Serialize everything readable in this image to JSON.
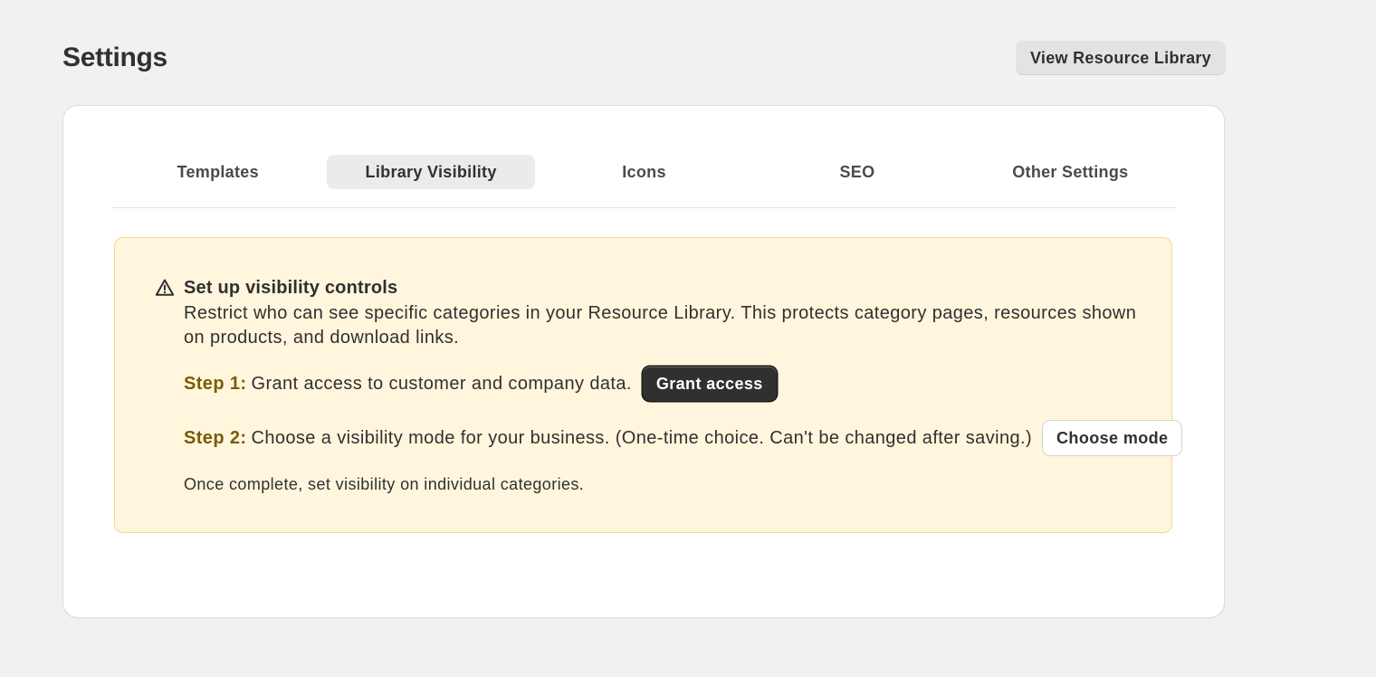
{
  "header": {
    "title": "Settings",
    "view_library_label": "View Resource Library"
  },
  "tabs": [
    {
      "label": "Templates",
      "active": false
    },
    {
      "label": "Library Visibility",
      "active": true
    },
    {
      "label": "Icons",
      "active": false
    },
    {
      "label": "SEO",
      "active": false
    },
    {
      "label": "Other Settings",
      "active": false
    }
  ],
  "banner": {
    "icon": "warning-triangle-icon",
    "title": "Set up visibility controls",
    "description": "Restrict who can see specific categories in your Resource Library. This protects category pages, resources shown on products, and download links.",
    "step1": {
      "label": "Step 1:",
      "text": "Grant access to customer and company data.",
      "button": "Grant access"
    },
    "step2": {
      "label": "Step 2:",
      "text": "Choose a visibility mode for your business. (One-time choice. Can't be changed after saving.)",
      "button": "Choose mode"
    },
    "footer": "Once complete, set visibility on individual categories."
  },
  "colors": {
    "background": "#f1f1f1",
    "banner_bg": "#fff6dd",
    "banner_border": "#f4d98a",
    "step_label": "#7b5a06",
    "primary_button": "#303030"
  }
}
